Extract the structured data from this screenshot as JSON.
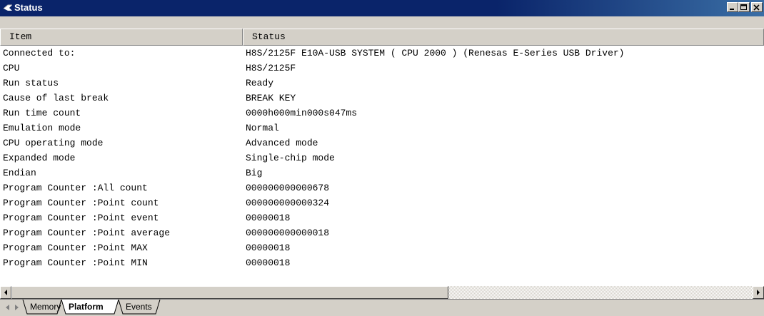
{
  "window": {
    "title": "Status"
  },
  "table": {
    "columns": [
      "Item",
      "Status"
    ],
    "rows": [
      {
        "item": "Connected to:",
        "status": "H8S/2125F E10A-USB SYSTEM ( CPU 2000 ) (Renesas E-Series USB Driver)"
      },
      {
        "item": "CPU",
        "status": "H8S/2125F"
      },
      {
        "item": "Run status",
        "status": "Ready"
      },
      {
        "item": "Cause of last break",
        "status": "BREAK KEY"
      },
      {
        "item": "Run time count",
        "status": "0000h000min000s047ms"
      },
      {
        "item": "Emulation mode",
        "status": "Normal"
      },
      {
        "item": "CPU operating mode",
        "status": "Advanced mode"
      },
      {
        "item": "Expanded mode",
        "status": "Single-chip mode"
      },
      {
        "item": "Endian",
        "status": "Big"
      },
      {
        "item": "Program Counter :All count",
        "status": "000000000000678"
      },
      {
        "item": "Program Counter :Point count",
        "status": "000000000000324"
      },
      {
        "item": "Program Counter :Point event",
        "status": "00000018"
      },
      {
        "item": "Program Counter :Point average",
        "status": "000000000000018"
      },
      {
        "item": "Program Counter :Point MAX",
        "status": "00000018"
      },
      {
        "item": "Program Counter :Point MIN",
        "status": "00000018"
      }
    ]
  },
  "tabs": [
    {
      "label": "Memory",
      "active": false
    },
    {
      "label": "Platform",
      "active": true
    },
    {
      "label": "Events",
      "active": false
    }
  ],
  "icons": {
    "title": "window-icon",
    "minimize": "minimize-icon",
    "maximize": "maximize-icon",
    "close": "close-icon",
    "scroll_left": "arrow-left-icon",
    "scroll_right": "arrow-right-icon",
    "tab_first": "tab-first-icon",
    "tab_last": "tab-last-icon"
  },
  "colors": {
    "titlebar_start": "#0a246a",
    "titlebar_end": "#3a6ea5",
    "face": "#d4d0c8",
    "list_bg": "#ffffff"
  }
}
